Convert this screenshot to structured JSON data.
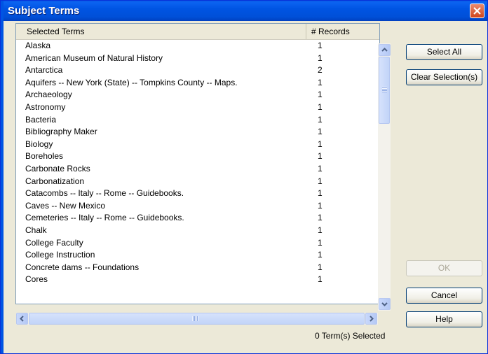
{
  "window": {
    "title": "Subject Terms"
  },
  "list": {
    "columns": [
      "Selected Terms",
      "# Records"
    ],
    "rows": [
      {
        "term": "Alaska",
        "records": "1"
      },
      {
        "term": "American Museum of Natural History",
        "records": "1"
      },
      {
        "term": "Antarctica",
        "records": "2"
      },
      {
        "term": "Aquifers -- New York (State) -- Tompkins County -- Maps.",
        "records": "1"
      },
      {
        "term": "Archaeology",
        "records": "1"
      },
      {
        "term": "Astronomy",
        "records": "1"
      },
      {
        "term": "Bacteria",
        "records": "1"
      },
      {
        "term": "Bibliography Maker",
        "records": "1"
      },
      {
        "term": "Biology",
        "records": "1"
      },
      {
        "term": "Boreholes",
        "records": "1"
      },
      {
        "term": "Carbonate Rocks",
        "records": "1"
      },
      {
        "term": "Carbonatization",
        "records": "1"
      },
      {
        "term": "Catacombs -- Italy -- Rome -- Guidebooks.",
        "records": "1"
      },
      {
        "term": "Caves -- New Mexico",
        "records": "1"
      },
      {
        "term": "Cemeteries -- Italy -- Rome -- Guidebooks.",
        "records": "1"
      },
      {
        "term": "Chalk",
        "records": "1"
      },
      {
        "term": "College Faculty",
        "records": "1"
      },
      {
        "term": "College Instruction",
        "records": "1"
      },
      {
        "term": "Concrete dams -- Foundations",
        "records": "1"
      },
      {
        "term": "Cores",
        "records": "1"
      }
    ]
  },
  "status": {
    "text": "0 Term(s) Selected"
  },
  "buttons": {
    "select_all": "Select All",
    "clear_selection": "Clear Selection(s)",
    "ok": "OK",
    "cancel": "Cancel",
    "help": "Help"
  },
  "icons": {
    "close": "close-icon",
    "scroll_up": "arrow-up-icon",
    "scroll_down": "arrow-down-icon",
    "scroll_left": "arrow-left-icon",
    "scroll_right": "arrow-right-icon"
  },
  "colors": {
    "titlebar": "#0054e3",
    "dialog_bg": "#ece9d8",
    "close_button": "#d0451b"
  }
}
